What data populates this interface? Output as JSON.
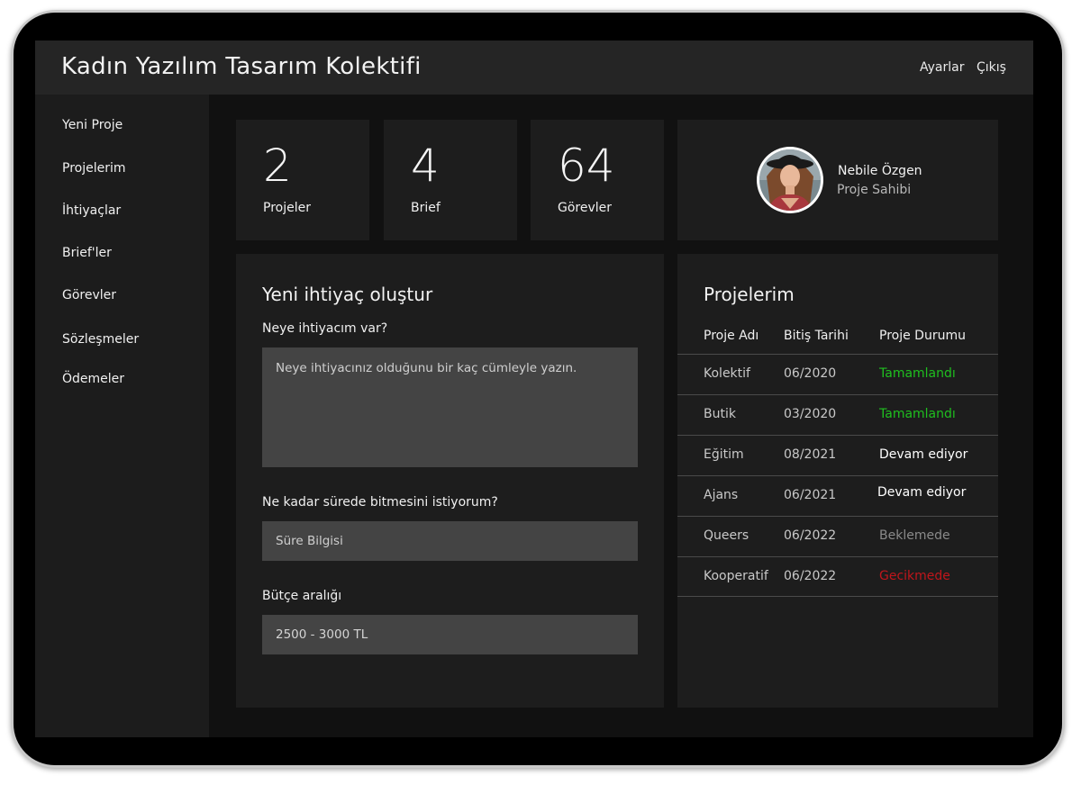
{
  "app": {
    "title": "Kadın Yazılım Tasarım Kolektifi"
  },
  "topnav": {
    "settings": "Ayarlar",
    "logout": "Çıkış"
  },
  "sidebar": {
    "items": [
      {
        "label": "Yeni Proje"
      },
      {
        "label": "Projelerim"
      },
      {
        "label": "İhtiyaçlar"
      },
      {
        "label": "Brief'ler"
      },
      {
        "label": "Görevler"
      },
      {
        "label": "Sözleşmeler"
      },
      {
        "label": "Ödemeler"
      }
    ]
  },
  "stats": [
    {
      "value": "2",
      "label": "Projeler"
    },
    {
      "value": "4",
      "label": "Brief"
    },
    {
      "value": "64",
      "label": "Görevler"
    }
  ],
  "profile": {
    "name": "Nebile Özgen",
    "role": "Proje Sahibi",
    "avatar_icon": "user-photo-icon"
  },
  "form": {
    "title": "Yeni ihtiyaç oluştur",
    "need_label": "Neye ihtiyacım var?",
    "need_placeholder": "Neye ihtiyacınız olduğunu bir kaç cümleyle yazın.",
    "duration_label": "Ne kadar sürede bitmesini istiyorum?",
    "duration_placeholder": "Süre Bilgisi",
    "budget_label": "Bütçe aralığı",
    "budget_value": "2500 - 3000 TL"
  },
  "projects": {
    "title": "Projelerim",
    "headers": [
      "Proje Adı",
      "Bitiş Tarihi",
      "Proje Durumu"
    ],
    "rows": [
      {
        "name": "Kolektif",
        "date": "06/2020",
        "status": "Tamamlandı",
        "status_color": "#1fbf1f"
      },
      {
        "name": "Butik",
        "date": "03/2020",
        "status": "Tamamlandı",
        "status_color": "#1fbf1f"
      },
      {
        "name": "Eğitim",
        "date": "08/2021",
        "status": "Devam ediyor",
        "status_color": "#ffffff"
      },
      {
        "name": "Ajans",
        "date": "06/2021",
        "status": "Devam ediyor",
        "status_color": "#ffffff"
      },
      {
        "name": "Queers",
        "date": "06/2022",
        "status": "Beklemede",
        "status_color": "#8a8a8a"
      },
      {
        "name": "Kooperatif",
        "date": "06/2022",
        "status": "Gecikmede",
        "status_color": "#c0161b"
      }
    ]
  }
}
